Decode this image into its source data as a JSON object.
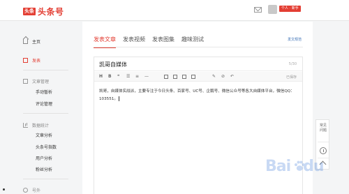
{
  "header": {
    "logo_badge": "头条",
    "logo_text": "头条号",
    "user_badge": "个人 · 新手"
  },
  "sidebar": {
    "items": [
      {
        "label": "主页",
        "icon": "home-icon"
      },
      {
        "label": "发表",
        "icon": "edit-icon",
        "active": true
      },
      {
        "label": "文章管理",
        "icon": "document-icon"
      },
      {
        "label": "手动暂析"
      },
      {
        "label": "评论管理"
      },
      {
        "label": "数据统计",
        "icon": "chart-icon"
      },
      {
        "label": "文章分析"
      },
      {
        "label": "头条号指数"
      },
      {
        "label": "用户分析"
      },
      {
        "label": "粉丝分析"
      },
      {
        "label": "号外",
        "icon": "extra-icon"
      }
    ]
  },
  "main": {
    "tabs": [
      {
        "label": "发表文章",
        "active": true
      },
      {
        "label": "发表视频"
      },
      {
        "label": "发表图集"
      },
      {
        "label": "趣味测试"
      }
    ],
    "spec_link": "发文规范",
    "editor": {
      "title": "凯哥自媒体",
      "char_count": "5/30",
      "toolbar_label": "已保存",
      "content": "凯哥，自媒体实战派，主要专注于今日头条、百家号、UC号、企鹅号、微信公众号等各大自媒体平台，微信QQ：103551。"
    }
  },
  "float_panel": {
    "faq": "常见问题"
  },
  "watermark": {
    "text": "Bai",
    "text2": "du"
  },
  "colors": {
    "brand": "#e33e33",
    "link": "#3a6fb5"
  }
}
